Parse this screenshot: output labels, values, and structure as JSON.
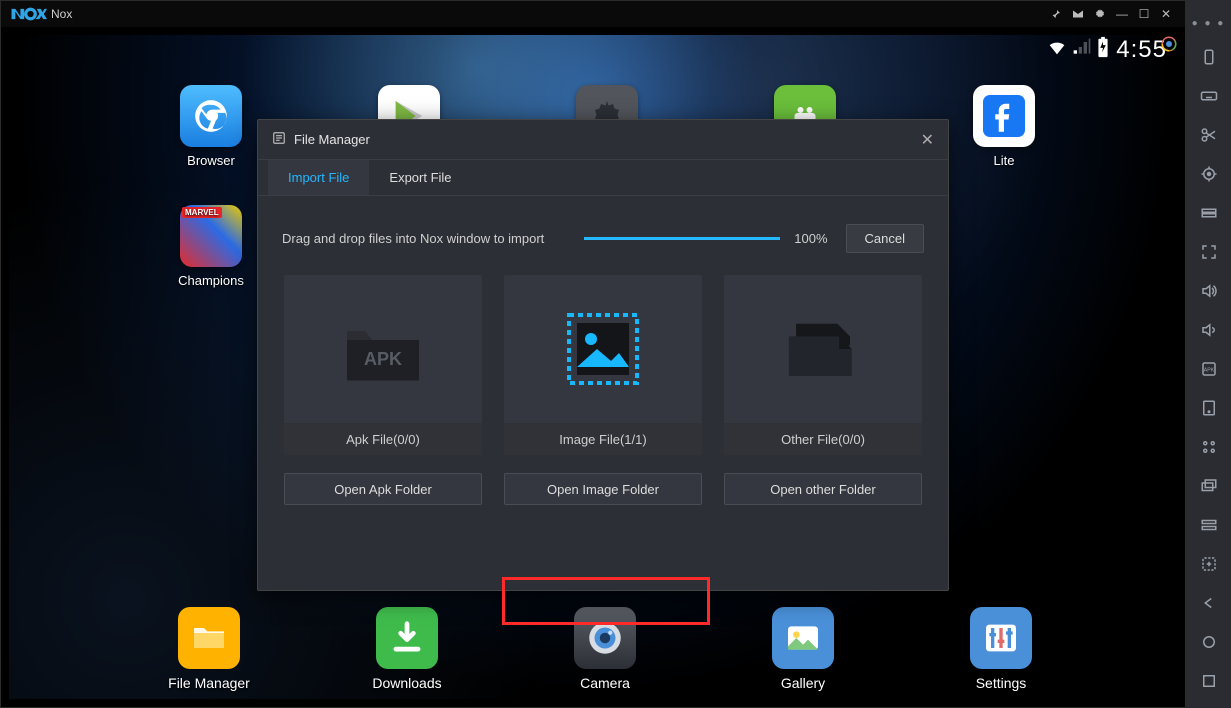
{
  "window": {
    "title": "Nox",
    "titlebar_icons": [
      "pin-icon",
      "mail-icon",
      "gear-icon",
      "minimize-icon",
      "maximize-icon",
      "close-icon"
    ]
  },
  "statusbar": {
    "clock": "4:55"
  },
  "desktop_icons": {
    "browser": "Browser",
    "champions": "Champions",
    "lite": "Lite"
  },
  "dock": {
    "file_manager": "File Manager",
    "downloads": "Downloads",
    "camera": "Camera",
    "gallery": "Gallery",
    "settings": "Settings"
  },
  "file_manager": {
    "title": "File Manager",
    "tabs": {
      "import": "Import File",
      "export": "Export File"
    },
    "hint": "Drag and drop files into Nox window to import",
    "progress_label": "100%",
    "cancel": "Cancel",
    "cards": {
      "apk": "Apk File(0/0)",
      "image": "Image File(1/1)",
      "other": "Other File(0/0)"
    },
    "open_buttons": {
      "apk": "Open Apk Folder",
      "image": "Open Image Folder",
      "other": "Open other Folder"
    }
  },
  "toolbar_icons": [
    "rotate-icon",
    "keyboard-icon",
    "scissors-icon",
    "location-icon",
    "layers-icon",
    "fullscreen-icon",
    "volume-up-icon",
    "volume-down-icon",
    "apk-install-icon",
    "folder-icon",
    "controls-icon",
    "screenshot-icon",
    "multi-instance-icon",
    "add-icon",
    "back-icon",
    "home-icon",
    "recent-icon"
  ]
}
